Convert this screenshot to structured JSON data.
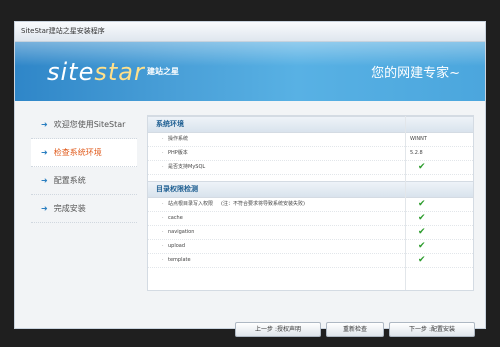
{
  "window": {
    "title": "SiteStar建站之星安装程序"
  },
  "banner": {
    "logo_en_1": "site",
    "logo_en_2": "star",
    "logo_cn": "建站之星",
    "tagline": "您的网建专家~"
  },
  "sidebar": {
    "items": [
      {
        "label": "欢迎您使用SiteStar",
        "active": false
      },
      {
        "label": "检查系统环境",
        "active": true
      },
      {
        "label": "配置系统",
        "active": false
      },
      {
        "label": "完成安装",
        "active": false
      }
    ]
  },
  "main": {
    "sections": [
      {
        "title": "系统环境",
        "rows": [
          {
            "label": "操作系统",
            "value": "WINNT",
            "check": false
          },
          {
            "label": "PHP版本",
            "value": "5.2.8",
            "check": false
          },
          {
            "label": "是否支持MySQL",
            "value": "",
            "check": true
          }
        ]
      },
      {
        "title": "目录权限检测",
        "rows": [
          {
            "label": "站点根目录写入权限",
            "note": "(注：不符合要求将导致系统安装失败)",
            "value": "",
            "check": true
          },
          {
            "label": "cache",
            "value": "",
            "check": true
          },
          {
            "label": "navigation",
            "value": "",
            "check": true
          },
          {
            "label": "upload",
            "value": "",
            "check": true
          },
          {
            "label": "template",
            "value": "",
            "check": true
          }
        ]
      }
    ],
    "check_glyph": "✔"
  },
  "buttons": {
    "prev": "上一步 :授权声明",
    "recheck": "重新检查",
    "next": "下一步 :配置安装"
  },
  "colors": {
    "accent": "#2b7fc1",
    "active_step": "#e05a1b",
    "check": "#2a9b2a"
  }
}
